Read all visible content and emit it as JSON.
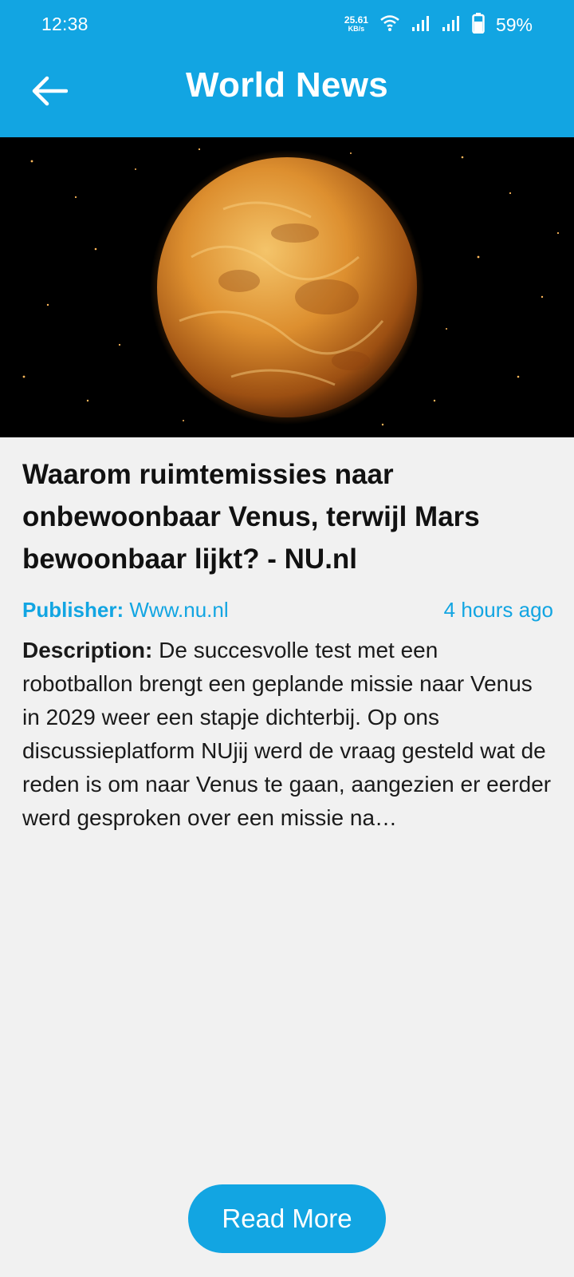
{
  "status_bar": {
    "time": "12:38",
    "net_speed_value": "25.61",
    "net_speed_unit": "KB/s",
    "battery": "59%"
  },
  "header": {
    "title": "World News",
    "back_icon": "arrow-left-icon"
  },
  "article": {
    "image": "venus-planet-image",
    "title": "Waarom ruimtemissies naar onbewoonbaar Venus, terwijl Mars bewoonbaar lijkt? - NU.nl",
    "publisher_label": "Publisher:",
    "publisher": "Www.nu.nl",
    "time_ago": "4 hours ago",
    "description_label": "Description:",
    "description": "De succesvolle test met een robotballon brengt een geplande missie naar Venus in 2029 weer een stapje dichterbij. Op ons discussieplatform NUjij werd de vraag gesteld wat de reden is om naar Venus te gaan, aangezien er eerder werd gesproken over een missie na…"
  },
  "actions": {
    "read_more_label": "Read More"
  },
  "colors": {
    "accent": "#12a5e2",
    "background": "#f1f1f1",
    "text": "#111111"
  }
}
